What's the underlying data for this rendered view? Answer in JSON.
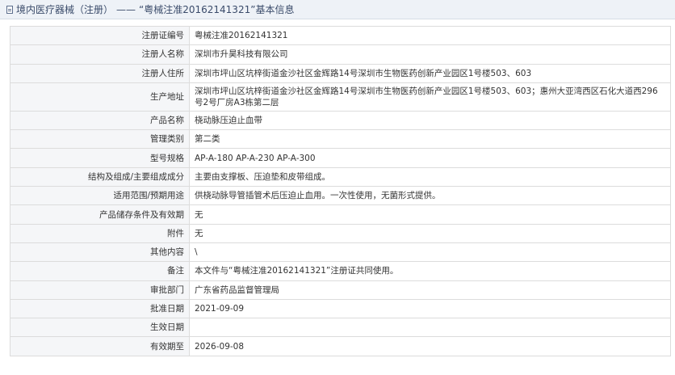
{
  "header": {
    "category": "境内医疗器械（注册）",
    "dash": "——",
    "reg_no_quoted": "“粤械注准20162141321”",
    "suffix": "基本信息"
  },
  "rows": [
    {
      "label": "注册证编号",
      "value": "粤械注准20162141321"
    },
    {
      "label": "注册人名称",
      "value": "深圳市升昊科技有限公司"
    },
    {
      "label": "注册人住所",
      "value": "深圳市坪山区坑梓街道金沙社区金辉路14号深圳市生物医药创新产业园区1号楼503、603"
    },
    {
      "label": "生产地址",
      "value": "深圳市坪山区坑梓街道金沙社区金辉路14号深圳市生物医药创新产业园区1号楼503、603；惠州大亚湾西区石化大道西296号2号厂房A3栋第二层"
    },
    {
      "label": "产品名称",
      "value": "桡动脉压迫止血带"
    },
    {
      "label": "管理类别",
      "value": "第二类"
    },
    {
      "label": "型号规格",
      "value": "AP-A-180 AP-A-230 AP-A-300"
    },
    {
      "label": "结构及组成/主要组成成分",
      "value": "主要由支撑板、压迫垫和皮带组成。"
    },
    {
      "label": "适用范围/预期用途",
      "value": "供桡动脉导管插管术后压迫止血用。一次性使用，无菌形式提供。"
    },
    {
      "label": "产品储存条件及有效期",
      "value": "无"
    },
    {
      "label": "附件",
      "value": "无"
    },
    {
      "label": "其他内容",
      "value": "\\"
    },
    {
      "label": "备注",
      "value": "本文件与“粤械注准20162141321”注册证共同使用。"
    },
    {
      "label": "审批部门",
      "value": "广东省药品监督管理局"
    },
    {
      "label": "批准日期",
      "value": "2021-09-09"
    },
    {
      "label": "生效日期",
      "value": ""
    },
    {
      "label": "有效期至",
      "value": "2026-09-08"
    }
  ]
}
